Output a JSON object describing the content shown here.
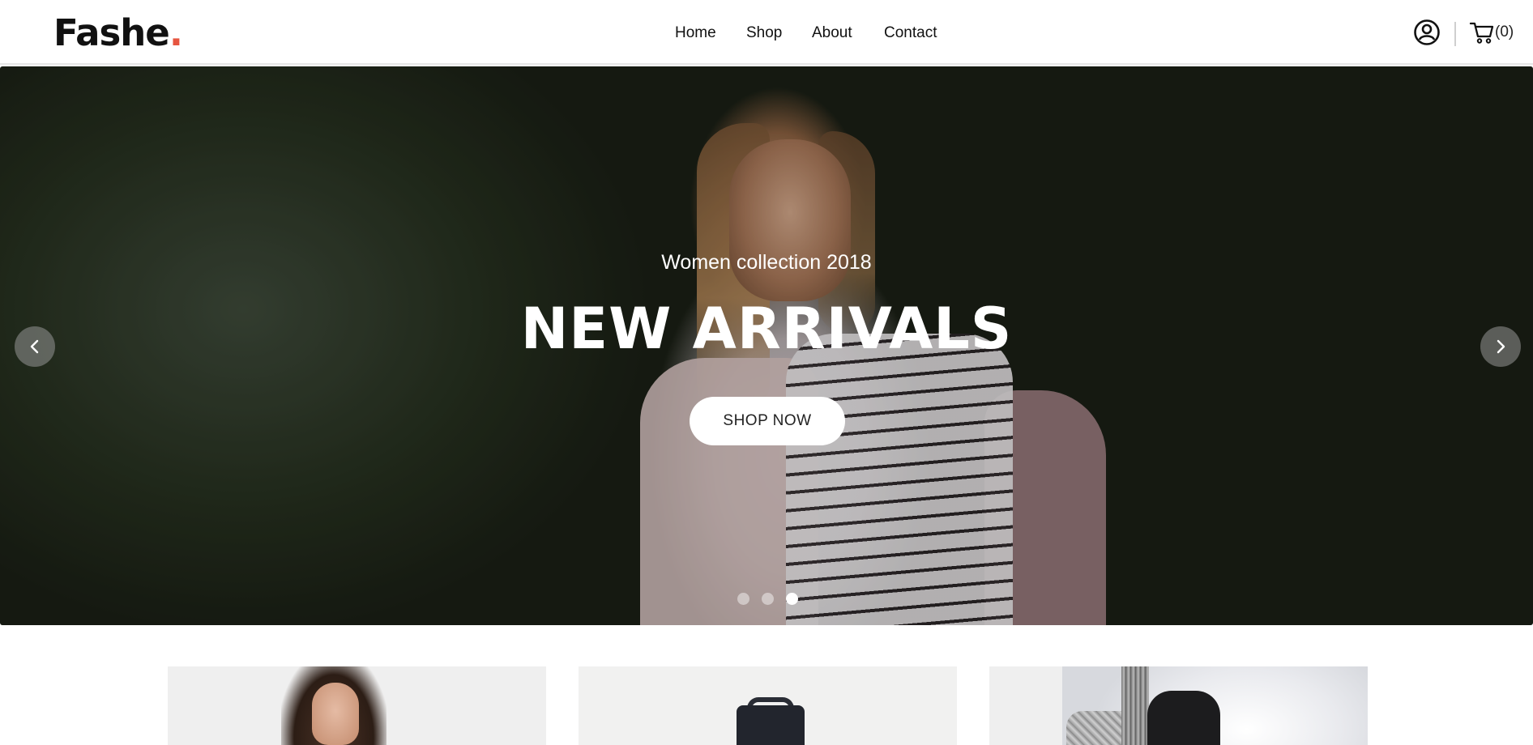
{
  "header": {
    "logo_text": "Fashe",
    "logo_dot": ".",
    "nav": [
      {
        "label": "Home"
      },
      {
        "label": "Shop"
      },
      {
        "label": "About"
      },
      {
        "label": "Contact"
      }
    ],
    "user_icon": "user-circle-icon",
    "cart_icon": "shopping-cart-icon",
    "cart_count": "(0)"
  },
  "hero": {
    "subtitle": "Women collection 2018",
    "title": "NEW ARRIVALS",
    "cta_label": "SHOP NOW",
    "prev_icon": "chevron-left-icon",
    "next_icon": "chevron-right-icon",
    "slide_count": 3,
    "active_slide": 3
  },
  "banners": [
    {
      "image": "woman-model-photo"
    },
    {
      "image": "black-handbag-photo"
    },
    {
      "image": "knit-bag-shoulder-photo"
    }
  ],
  "colors": {
    "accent": "#e65540",
    "text": "#111111",
    "header_bg": "#ffffff",
    "cta_bg": "#ffffff"
  }
}
